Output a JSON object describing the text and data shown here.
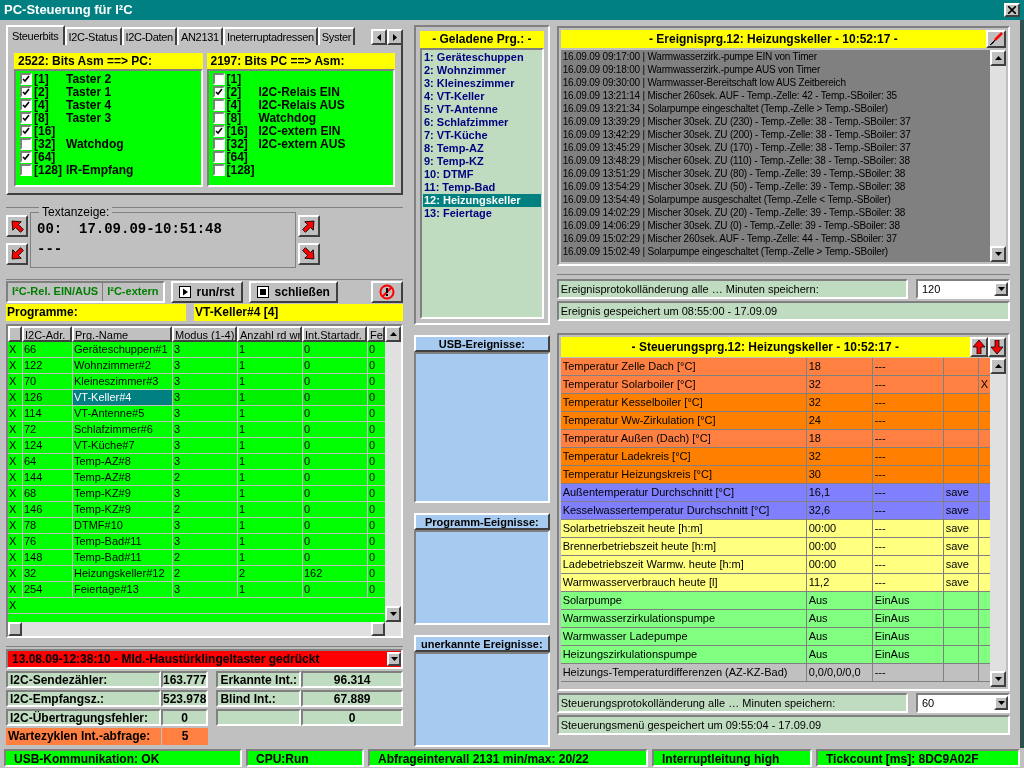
{
  "window": {
    "title": "PC-Steuerung für I²C"
  },
  "tabs": [
    {
      "label": "Steuerbits",
      "selected": true
    },
    {
      "label": "I2C-Status",
      "selected": false
    },
    {
      "label": "I2C-Daten",
      "selected": false
    },
    {
      "label": "AN2131",
      "selected": false
    },
    {
      "label": "Ineterruptadressen",
      "selected": false
    },
    {
      "label": "Syster",
      "selected": false
    }
  ],
  "bits_in": {
    "title": "2522: Bits Asm ==> PC:",
    "items": [
      {
        "bit": "[1]",
        "label": "Taster 2",
        "checked": true
      },
      {
        "bit": "[2]",
        "label": "Taster 1",
        "checked": true
      },
      {
        "bit": "[4]",
        "label": "Taster 4",
        "checked": true
      },
      {
        "bit": "[8]",
        "label": "Taster 3",
        "checked": true
      },
      {
        "bit": "[16]",
        "checked": true
      },
      {
        "bit": "[32]",
        "label": "Watchdog",
        "checked": false
      },
      {
        "bit": "[64]",
        "checked": true
      },
      {
        "bit": "[128]",
        "label": "IR-Empfang",
        "checked": false
      }
    ]
  },
  "bits_out": {
    "title": "2197: Bits PC ==> Asm:",
    "items": [
      {
        "bit": "[1]",
        "checked": false
      },
      {
        "bit": "[2]",
        "label": "I2C-Relais EIN",
        "checked": true
      },
      {
        "bit": "[4]",
        "label": "I2C-Relais AUS",
        "checked": false
      },
      {
        "bit": "[8]",
        "label": "Watchdog",
        "checked": false
      },
      {
        "bit": "[16]",
        "label": "I2C-extern EIN",
        "checked": true
      },
      {
        "bit": "[32]",
        "label": "I2C-extern AUS",
        "checked": false
      },
      {
        "bit": "[64]",
        "checked": false
      },
      {
        "bit": "[128]",
        "checked": false
      }
    ]
  },
  "text_display": {
    "legend": "Textanzeige:",
    "lines": [
      "00:  17.09.09-10:51:48",
      "---"
    ]
  },
  "mode_buttons": [
    "I²C-Rel. EIN/AUS",
    "I²C-extern"
  ],
  "actions": [
    {
      "kind": "play",
      "label": "run/rst"
    },
    {
      "kind": "stop",
      "label": "schließen"
    },
    {
      "kind": "halt"
    }
  ],
  "programs_label": "Programme:",
  "current_program": "VT-Keller#4 [4]",
  "program_table": {
    "columns": [
      "I2C-Adr.",
      "Prg.-Name",
      "Modus (1-4)",
      "Anzahl rd wr",
      "Int.Startadr.",
      "Fe"
    ],
    "rows": [
      {
        "flag": "X",
        "cells": [
          "66",
          "Geräteschuppen#1",
          "3",
          "1",
          "0",
          "0"
        ],
        "selected": false
      },
      {
        "flag": "X",
        "cells": [
          "122",
          "Wohnzimmer#2",
          "3",
          "1",
          "0",
          "0"
        ],
        "selected": false
      },
      {
        "flag": "X",
        "cells": [
          "70",
          "Kleineszimmer#3",
          "3",
          "1",
          "0",
          "0"
        ],
        "selected": false
      },
      {
        "flag": "X",
        "cells": [
          "126",
          "VT-Keller#4",
          "3",
          "1",
          "0",
          "0"
        ],
        "selected": true
      },
      {
        "flag": "X",
        "cells": [
          "114",
          "VT-Antenne#5",
          "3",
          "1",
          "0",
          "0"
        ],
        "selected": false
      },
      {
        "flag": "X",
        "cells": [
          "72",
          "Schlafzimmer#6",
          "3",
          "1",
          "0",
          "0"
        ],
        "selected": false
      },
      {
        "flag": "X",
        "cells": [
          "124",
          "VT-Küche#7",
          "3",
          "1",
          "0",
          "0"
        ],
        "selected": false
      },
      {
        "flag": "X",
        "cells": [
          "64",
          "Temp-AZ#8",
          "3",
          "1",
          "0",
          "0"
        ],
        "selected": false
      },
      {
        "flag": "X",
        "cells": [
          "144",
          "Temp-AZ#8",
          "2",
          "1",
          "0",
          "0"
        ],
        "selected": false
      },
      {
        "flag": "X",
        "cells": [
          "68",
          "Temp-KZ#9",
          "3",
          "1",
          "0",
          "0"
        ],
        "selected": false
      },
      {
        "flag": "X",
        "cells": [
          "146",
          "Temp-KZ#9",
          "2",
          "1",
          "0",
          "0"
        ],
        "selected": false
      },
      {
        "flag": "X",
        "cells": [
          "78",
          "DTMF#10",
          "3",
          "1",
          "0",
          "0"
        ],
        "selected": false
      },
      {
        "flag": "X",
        "cells": [
          "76",
          "Temp-Bad#11",
          "3",
          "1",
          "0",
          "0"
        ],
        "selected": false
      },
      {
        "flag": "X",
        "cells": [
          "148",
          "Temp-Bad#11",
          "2",
          "1",
          "0",
          "0"
        ],
        "selected": false
      },
      {
        "flag": "X",
        "cells": [
          "32",
          "Heizungskeller#12",
          "2",
          "2",
          "162",
          "0"
        ],
        "selected": false
      },
      {
        "flag": "X",
        "cells": [
          "254",
          "Feiertage#13",
          "3",
          "1",
          "0",
          "0"
        ],
        "selected": false
      },
      {
        "flag": "X",
        "cells": [],
        "selected": false
      }
    ]
  },
  "alert": "13.08.09-12:38:10 - Mld.-Haustürklingeltaster gedrückt",
  "counters_left": [
    {
      "label": "I2C-Sendezähler:",
      "value": "163.777"
    },
    {
      "label": "I2C-Empfangsz.:",
      "value": "523.978"
    },
    {
      "label": "I2C-Übertragungsfehler:",
      "value": "0"
    }
  ],
  "counters_right": [
    {
      "label": "Erkannte Int.:",
      "value": "96.314"
    },
    {
      "label": "Blind Int.:",
      "value": "67.889"
    },
    {
      "value": "0"
    }
  ],
  "wait": {
    "label": "Wartezyklen Int.-abfrage:",
    "value": "5"
  },
  "loaded": {
    "title": "- Geladene Prg.: -",
    "items": [
      {
        "label": "1: Geräteschuppen",
        "selected": false
      },
      {
        "label": "2: Wohnzimmer",
        "selected": false
      },
      {
        "label": "3: Kleineszimmer",
        "selected": false
      },
      {
        "label": "4: VT-Keller",
        "selected": false
      },
      {
        "label": "5: VT-Antenne",
        "selected": false
      },
      {
        "label": "6: Schlafzimmer",
        "selected": false
      },
      {
        "label": "7: VT-Küche",
        "selected": false
      },
      {
        "label": "8: Temp-AZ",
        "selected": false
      },
      {
        "label": "9: Temp-KZ",
        "selected": false
      },
      {
        "label": "10: DTMF",
        "selected": false
      },
      {
        "label": "11: Temp-Bad",
        "selected": false
      },
      {
        "label": "12: Heizungskeller",
        "selected": true
      },
      {
        "label": "13: Feiertage",
        "selected": false
      }
    ]
  },
  "event_panels": [
    "USB-Ereignisse:",
    "Programm-Eeignisse:",
    "unerkannte Ereignisse:"
  ],
  "event_log": {
    "title": "- Ereignisprg.12: Heizungskeller - 10:52:17 -",
    "lines": [
      "16.09.09 09:17:00 | Warmwasserzirk.-pumpe EIN von Timer",
      "16.09.09 09:18:00 | Warmwasserzirk.-pumpe AUS von Timer",
      "16.09.09 09:30:00 | Warmwasser-Bereitschaft low AUS Zeitbereich",
      "16.09.09 13:21:14 | Mischer 260sek. AUF - Temp.-Zelle: 42 - Temp.-SBoiler: 35",
      "16.09.09 13:21:34 | Solarpumpe eingeschaltet (Temp.-Zelle > Temp.-SBoiler)",
      "16.09.09 13:39:29 | Mischer 30sek. ZU (230) - Temp.-Zelle: 38 - Temp.-SBoiler: 37",
      "16.09.09 13:42:29 | Mischer 30sek. ZU (200) - Temp.-Zelle: 38 - Temp.-SBoiler: 37",
      "16.09.09 13:45:29 | Mischer 30sek. ZU (170) - Temp.-Zelle: 38 - Temp.-SBoiler: 37",
      "16.09.09 13:48:29 | Mischer 60sek. ZU (110) - Temp.-Zelle: 38 - Temp.-SBoiler: 38",
      "16.09.09 13:51:29 | Mischer 30sek. ZU (80) - Temp.-Zelle: 39 - Temp.-SBoiler: 38",
      "16.09.09 13:54:29 | Mischer 30sek. ZU (50) - Temp.-Zelle: 39 - Temp.-SBoiler: 38",
      "16.09.09 13:54:49 | Solarpumpe ausgeschaltet (Temp.-Zelle < Temp.-SBoiler)",
      "16.09.09 14:02:29 | Mischer 30sek. ZU (20) - Temp.-Zelle: 39 - Temp.-SBoiler: 38",
      "16.09.09 14:06:29 | Mischer 30sek. ZU (0) - Temp.-Zelle: 39 - Temp.-SBoiler: 38",
      "16.09.09 15:02:29 | Mischer 260sek. AUF - Temp.-Zelle: 44 - Temp.-SBoiler: 37",
      "16.09.09 15:02:49 | Solarpumpe eingeschaltet (Temp.-Zelle > Temp.-SBoiler)"
    ],
    "save_label": "Ereignisprotokolländerung alle … Minuten speichern:",
    "save_value": "120",
    "saved_note": "Ereignis gespeichert um 08:55:00 - 17.09.09"
  },
  "control": {
    "title": "- Steuerungsprg.12: Heizungskeller - 10:52:17 -",
    "rows": [
      {
        "name": "Temperatur Zelle Dach [°C]",
        "value": "18",
        "mode": "---",
        "color": "#ff8040"
      },
      {
        "name": "Temperatur Solarboiler [°C]",
        "value": "32",
        "mode": "---",
        "flag": "X",
        "color": "#ff8040"
      },
      {
        "name": "Temperatur Kesselboiler [°C]",
        "value": "32",
        "mode": "---",
        "color": "#ff8000"
      },
      {
        "name": "Temperatur Ww-Zirkulation [°C]",
        "value": "24",
        "mode": "---",
        "color": "#ff8000"
      },
      {
        "name": "Temperatur Außen (Dach) [°C]",
        "value": "18",
        "mode": "---",
        "color": "#ff8040"
      },
      {
        "name": "Temperatur Ladekreis [°C]",
        "value": "32",
        "mode": "---",
        "color": "#ff8000"
      },
      {
        "name": "Temperatur Heizungskreis [°C]",
        "value": "30",
        "mode": "---",
        "color": "#ff8000"
      },
      {
        "name": "Außentemperatur Durchschnitt [°C]",
        "value": "16,1",
        "mode": "---",
        "save": "save",
        "color": "#8080ff"
      },
      {
        "name": "Kesselwassertemperatur Durchschnitt [°C]",
        "value": "32,6",
        "mode": "---",
        "save": "save",
        "color": "#8080ff"
      },
      {
        "name": "Solarbetriebszeit heute [h:m]",
        "value": "00:00",
        "mode": "---",
        "save": "save",
        "color": "#ffff80"
      },
      {
        "name": "Brennerbetriebszeit heute [h:m]",
        "value": "00:00",
        "mode": "---",
        "save": "save",
        "color": "#ffff80"
      },
      {
        "name": "Ladebetriebszeit Warmw. heute [h:m]",
        "value": "00:00",
        "mode": "---",
        "save": "save",
        "color": "#ffff80"
      },
      {
        "name": "Warmwasserverbrauch heute [l]",
        "value": "11,2",
        "mode": "---",
        "save": "save",
        "color": "#ffff80"
      },
      {
        "name": "Solarpumpe",
        "value": "Aus",
        "mode": "EinAus",
        "color": "#80ff80"
      },
      {
        "name": "Warmwasserzirkulationspumpe",
        "value": "Aus",
        "mode": "EinAus",
        "color": "#80ff80"
      },
      {
        "name": "Warmwasser Ladepumpe",
        "value": "Aus",
        "mode": "EinAus",
        "color": "#80ff80"
      },
      {
        "name": "Heizungszirkulationspumpe",
        "value": "Aus",
        "mode": "EinAus",
        "color": "#80ff80"
      },
      {
        "name": "Heizungs-Temperaturdifferenzen (AZ-KZ-Bad)",
        "value": "0,0/0,0/0,0",
        "mode": "---",
        "color": "#c0c0c0"
      }
    ],
    "save_label": "Steuerungsprotokolländerung alle … Minuten speichern:",
    "save_value": "60",
    "saved_note": "Steuerungsmenü gespeichert um 09:55:04 - 17.09.09"
  },
  "status_bar": [
    "USB-Kommunikation: OK",
    "CPU:Run",
    "Abfrageintervall 2131 min/max: 20/22",
    "Interruptleitung high",
    "Tickcount [ms]: 8DC9A02F"
  ]
}
